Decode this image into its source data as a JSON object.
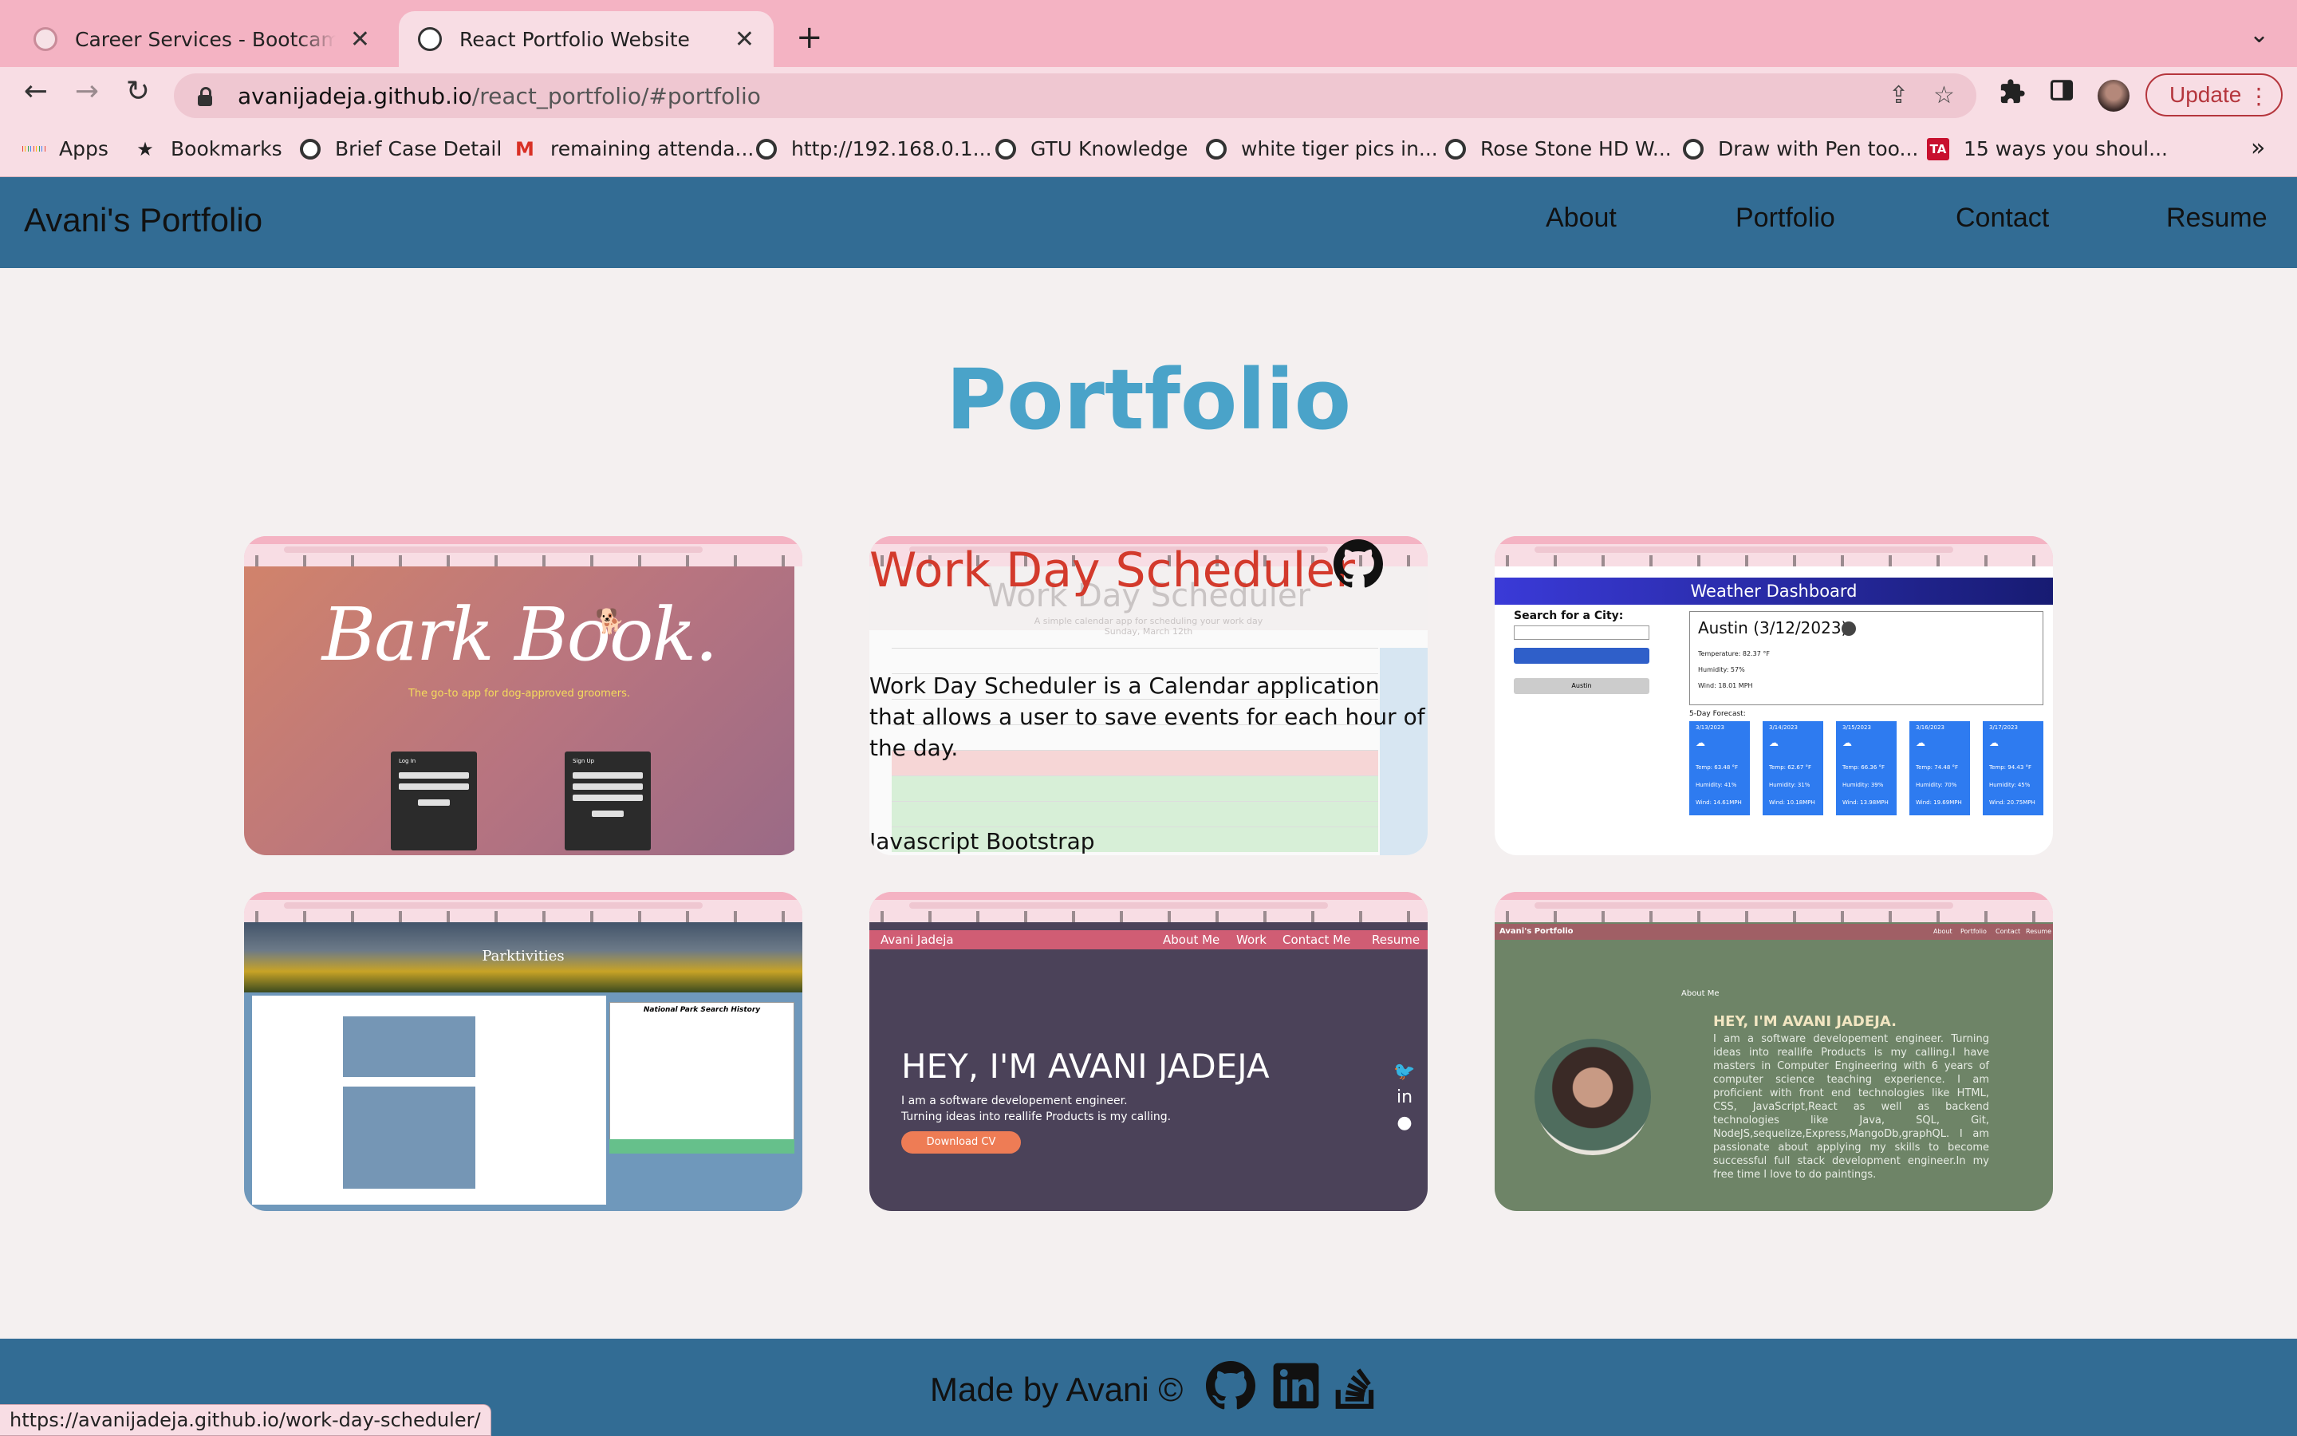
{
  "browser": {
    "tabs": [
      {
        "title": "Career Services - Bootcamp: Ur",
        "active": false
      },
      {
        "title": "React Portfolio Website",
        "active": true
      }
    ],
    "close_glyph": "✕",
    "new_tab_glyph": "+",
    "tab_menu_glyph": "⌄",
    "url_host": "avanijadeja.github.io",
    "url_path": "/react_portfolio/#portfolio",
    "update_label": "Update",
    "bookmarks": [
      {
        "label": "Apps",
        "icon": "apps-grid-icon"
      },
      {
        "label": "Bookmarks",
        "icon": "star-icon"
      },
      {
        "label": "Brief Case Detail",
        "icon": "globe-icon"
      },
      {
        "label": "remaining attenda...",
        "icon": "gmail-icon"
      },
      {
        "label": "http://192.168.0.1...",
        "icon": "globe-icon"
      },
      {
        "label": "GTU Knowledge",
        "icon": "globe-icon"
      },
      {
        "label": "white tiger pics in...",
        "icon": "globe-icon"
      },
      {
        "label": "Rose Stone HD W...",
        "icon": "globe-icon"
      },
      {
        "label": "Draw with Pen too...",
        "icon": "globe-icon"
      },
      {
        "label": "15 ways you shoul...",
        "icon": "ta-icon"
      }
    ],
    "more_glyph": "»",
    "status_url": "https://avanijadeja.github.io/work-day-scheduler/"
  },
  "site": {
    "brand": "Avani's Portfolio",
    "nav": [
      "About",
      "Portfolio",
      "Contact",
      "Resume"
    ],
    "page_title": "Portfolio",
    "footer_text": "Made by Avani ©"
  },
  "projects": {
    "bark": {
      "title": "Bark Book.",
      "subtitle": "The go-to app for dog-approved groomers.",
      "login": "Log In",
      "signup": "Sign Up"
    },
    "scheduler": {
      "title": "Work Day Scheduler",
      "ghost_title": "Work Day Scheduler",
      "ghost_subtitle": "A simple calendar app for scheduling your work day",
      "ghost_date": "Sunday, March 12th",
      "description": "Work Day Scheduler is a Calendar application that allows a user to save events for each hour of the day.",
      "tech": "Javascript Bootstrap"
    },
    "weather": {
      "header": "Weather Dashboard",
      "search_label": "Search for a City:",
      "city_button": "Austin",
      "current_city": "Austin (3/12/2023)",
      "current_lines": [
        "Temperature: 82.37 °F",
        "Humidity: 57%",
        "Wind: 18.01 MPH"
      ],
      "forecast_label": "5-Day Forecast:",
      "forecast": [
        {
          "date": "3/13/2023",
          "temp": "Temp: 63.48 °F",
          "hum": "Humidity: 41%",
          "wind": "Wind: 14.61MPH"
        },
        {
          "date": "3/14/2023",
          "temp": "Temp: 62.67 °F",
          "hum": "Humidity: 31%",
          "wind": "Wind: 10.18MPH"
        },
        {
          "date": "3/15/2023",
          "temp": "Temp: 66.36 °F",
          "hum": "Humidity: 39%",
          "wind": "Wind: 13.98MPH"
        },
        {
          "date": "3/16/2023",
          "temp": "Temp: 74.48 °F",
          "hum": "Humidity: 70%",
          "wind": "Wind: 19.69MPH"
        },
        {
          "date": "3/17/2023",
          "temp": "Temp: 94.43 °F",
          "hum": "Humidity: 45%",
          "wind": "Wind: 20.75MPH"
        }
      ]
    },
    "parks": {
      "title": "Parktivities",
      "history_title": "National Park Search History"
    },
    "avani": {
      "brand": "Avani Jadeja",
      "nav": [
        "About Me",
        "Work",
        "Contact Me",
        "Resume"
      ],
      "hero": "HEY, I'M AVANI JADEJA",
      "line1": "I am a software developement engineer.",
      "line2": "Turning ideas into reallife Products is my calling.",
      "cv_button": "Download CV"
    },
    "about": {
      "brand": "Avani's Portfolio",
      "nav": [
        "About",
        "Portfolio",
        "Contact",
        "Resume"
      ],
      "label": "About Me",
      "heading": "HEY, I'M AVANI JADEJA.",
      "paragraph": "I am a software developement engineer. Turning ideas into reallife Products is my calling.I have masters in Computer Engineering with 6 years of computer science teaching experience. I am proficient with front end technologies like HTML, CSS, JavaScript,React as well as backend technologies like Java, SQL, Git, NodeJS,sequelize,Express,MangoDb,graphQL. I am passionate about applying my skills to become successful full stack development engineer.In my free time I love to do paintings."
    }
  },
  "colors": {
    "tabbar": "#f4b3c3",
    "header": "#326c94",
    "title": "#4aa3c9",
    "scheduler_title": "#d33a2c"
  }
}
